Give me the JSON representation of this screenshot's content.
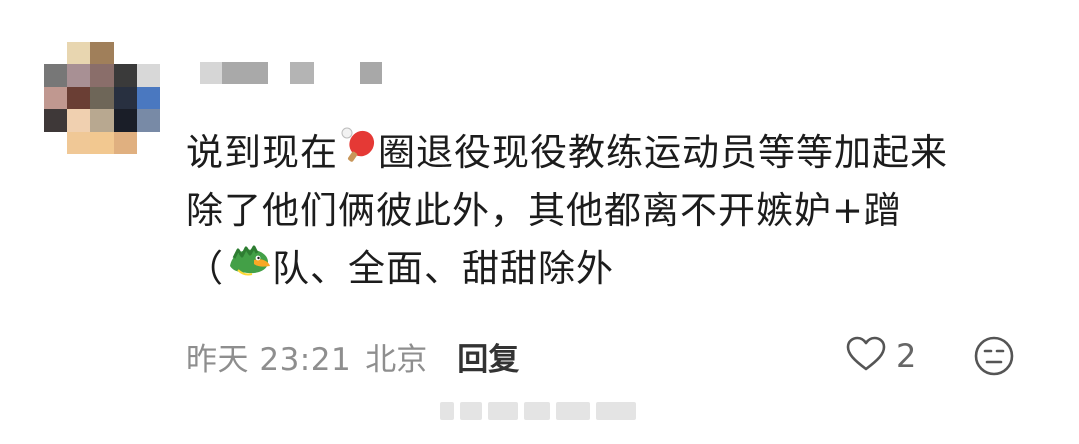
{
  "comment": {
    "lines": [
      [
        "说到现在",
        "圈退役现役教练运动员等等加起来"
      ],
      [
        "除了他们俩彼此外，其他都离不开嫉妒+蹭"
      ],
      [
        "（",
        "队、全面、甜甜除外"
      ]
    ],
    "emoji_icons": [
      "ping-pong-paddle-icon",
      "dragon-icon"
    ],
    "time": "昨天 23:21",
    "location": "北京",
    "reply_label": "回复",
    "like_count": "2"
  },
  "avatar": {
    "pixels": [
      [
        "#ffffff",
        "#e8d6b0",
        "#a07f5a",
        "#ffffff",
        "#ffffff"
      ],
      [
        "#777777",
        "#a89094",
        "#8a6e6a",
        "#3a3a3a",
        "#d8d8d8"
      ],
      [
        "#c09890",
        "#6a3e34",
        "#6e6658",
        "#283040",
        "#4a78c0"
      ],
      [
        "#3e3838",
        "#f0d0b0",
        "#b8a890",
        "#1a1e28",
        "#788aa6"
      ],
      [
        "#ffffff",
        "#f0c896",
        "#f2c890",
        "#e0b080",
        "#ffffff"
      ]
    ]
  },
  "colors": {
    "text": "#1c1c1c",
    "meta": "#8e8e8e",
    "reply": "#333333",
    "icon": "#555555"
  }
}
